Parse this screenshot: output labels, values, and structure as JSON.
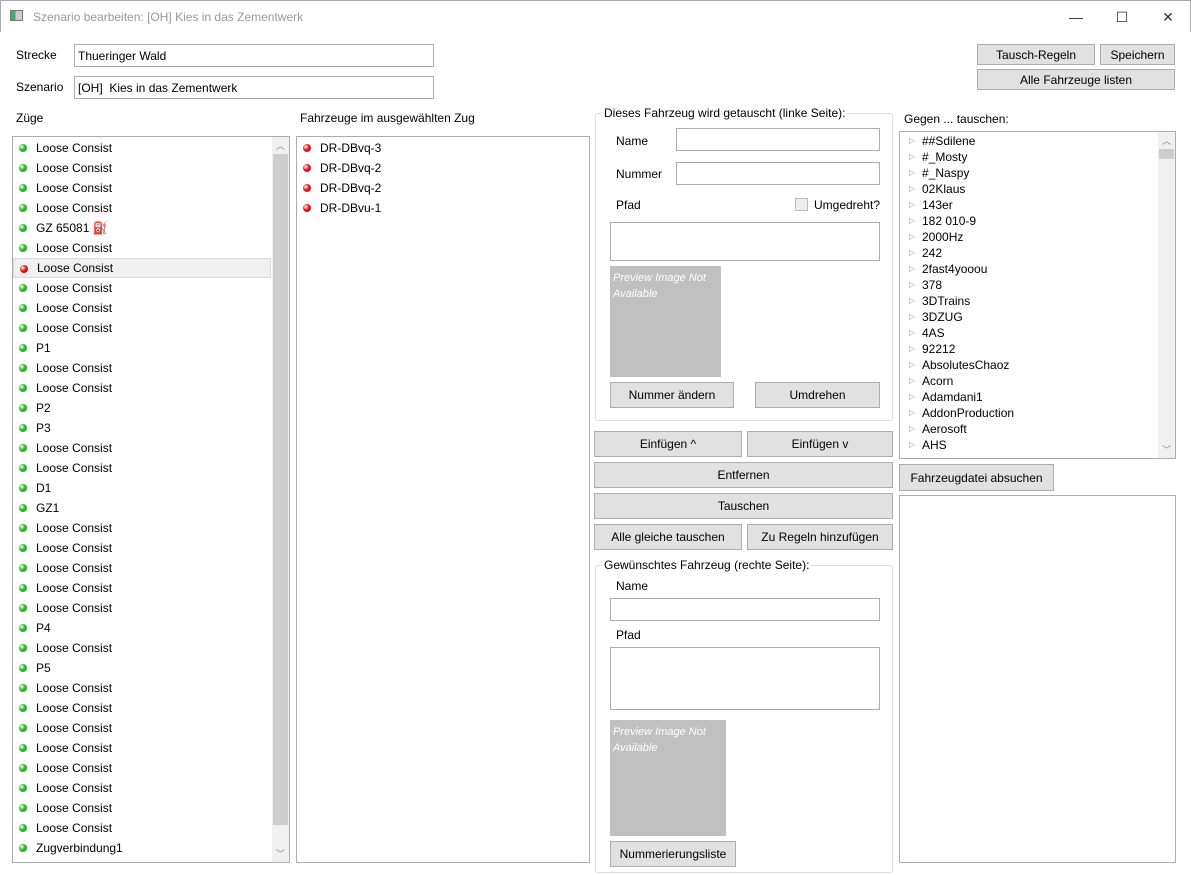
{
  "window": {
    "title": "Szenario bearbeiten: [OH]  Kies in das Zementwerk",
    "minimize": "—",
    "maximize": "☐",
    "close": "✕"
  },
  "header": {
    "strecke_label": "Strecke",
    "strecke_value": "Thueringer Wald",
    "szenario_label": "Szenario",
    "szenario_value": "[OH]  Kies in das Zementwerk",
    "tausch_regeln": "Tausch-Regeln",
    "speichern": "Speichern",
    "alle_fahrzeuge": "Alle Fahrzeuge listen"
  },
  "colors": {
    "green": "#1db81d",
    "red": "#dd1111"
  },
  "zuege": {
    "label": "Züge",
    "items": [
      {
        "t": "Loose Consist",
        "c": "green"
      },
      {
        "t": "Loose Consist",
        "c": "green"
      },
      {
        "t": "Loose Consist",
        "c": "green"
      },
      {
        "t": "Loose Consist",
        "c": "green"
      },
      {
        "t": "GZ 65081 ⛽",
        "c": "green"
      },
      {
        "t": "Loose Consist",
        "c": "green"
      },
      {
        "t": "Loose Consist",
        "c": "red",
        "sel": true
      },
      {
        "t": "Loose Consist",
        "c": "green"
      },
      {
        "t": "Loose Consist",
        "c": "green"
      },
      {
        "t": "Loose Consist",
        "c": "green"
      },
      {
        "t": "P1",
        "c": "green"
      },
      {
        "t": "Loose Consist",
        "c": "green"
      },
      {
        "t": "Loose Consist",
        "c": "green"
      },
      {
        "t": "P2",
        "c": "green"
      },
      {
        "t": "P3",
        "c": "green"
      },
      {
        "t": "Loose Consist",
        "c": "green"
      },
      {
        "t": "Loose Consist",
        "c": "green"
      },
      {
        "t": "D1",
        "c": "green"
      },
      {
        "t": "GZ1",
        "c": "green"
      },
      {
        "t": "Loose Consist",
        "c": "green"
      },
      {
        "t": "Loose Consist",
        "c": "green"
      },
      {
        "t": "Loose Consist",
        "c": "green"
      },
      {
        "t": "Loose Consist",
        "c": "green"
      },
      {
        "t": "Loose Consist",
        "c": "green"
      },
      {
        "t": "P4",
        "c": "green"
      },
      {
        "t": "Loose Consist",
        "c": "green"
      },
      {
        "t": "P5",
        "c": "green"
      },
      {
        "t": "Loose Consist",
        "c": "green"
      },
      {
        "t": "Loose Consist",
        "c": "green"
      },
      {
        "t": "Loose Consist",
        "c": "green"
      },
      {
        "t": "Loose Consist",
        "c": "green"
      },
      {
        "t": "Loose Consist",
        "c": "green"
      },
      {
        "t": "Loose Consist",
        "c": "green"
      },
      {
        "t": "Loose Consist",
        "c": "green"
      },
      {
        "t": "Loose Consist",
        "c": "green"
      },
      {
        "t": "Zugverbindung1",
        "c": "green"
      }
    ]
  },
  "fahrzeuge": {
    "label": "Fahrzeuge im ausgewählten Zug",
    "items": [
      {
        "t": "DR-DBvq-3",
        "c": "red"
      },
      {
        "t": "DR-DBvq-2",
        "c": "red"
      },
      {
        "t": "DR-DBvq-2",
        "c": "red"
      },
      {
        "t": "DR-DBvu-1",
        "c": "red"
      }
    ]
  },
  "links": {
    "group_label": "Dieses Fahrzeug wird getauscht (linke Seite):",
    "name_label": "Name",
    "nummer_label": "Nummer",
    "pfad_label": "Pfad",
    "umgedreht_label": "Umgedreht?",
    "preview": "Preview Image Not Available",
    "nummer_aendern": "Nummer ändern",
    "umdrehen": "Umdrehen"
  },
  "actions": {
    "einfuegen_up": "Einfügen ^",
    "einfuegen_down": "Einfügen v",
    "entfernen": "Entfernen",
    "tauschen": "Tauschen",
    "alle_gleiche": "Alle gleiche tauschen",
    "zu_regeln": "Zu Regeln hinzufügen"
  },
  "rechts": {
    "group_label": "Gewünschtes Fahrzeug (rechte Seite):",
    "name_label": "Name",
    "pfad_label": "Pfad",
    "preview": "Preview Image Not Available",
    "nummerierungsliste": "Nummerierungsliste"
  },
  "gegen": {
    "label": "Gegen ... tauschen:",
    "items": [
      "##Sdilene",
      "#_Mosty",
      "#_Naspy",
      "02Klaus",
      "143er",
      "182 010-9",
      "2000Hz",
      "242",
      "2fast4yooou",
      "378",
      "3DTrains",
      "3DZUG",
      "4AS",
      "92212",
      "AbsolutesChaoz",
      "Acorn",
      "Adamdani1",
      "AddonProduction",
      "Aerosoft",
      "AHS"
    ],
    "search_button": "Fahrzeugdatei absuchen"
  }
}
